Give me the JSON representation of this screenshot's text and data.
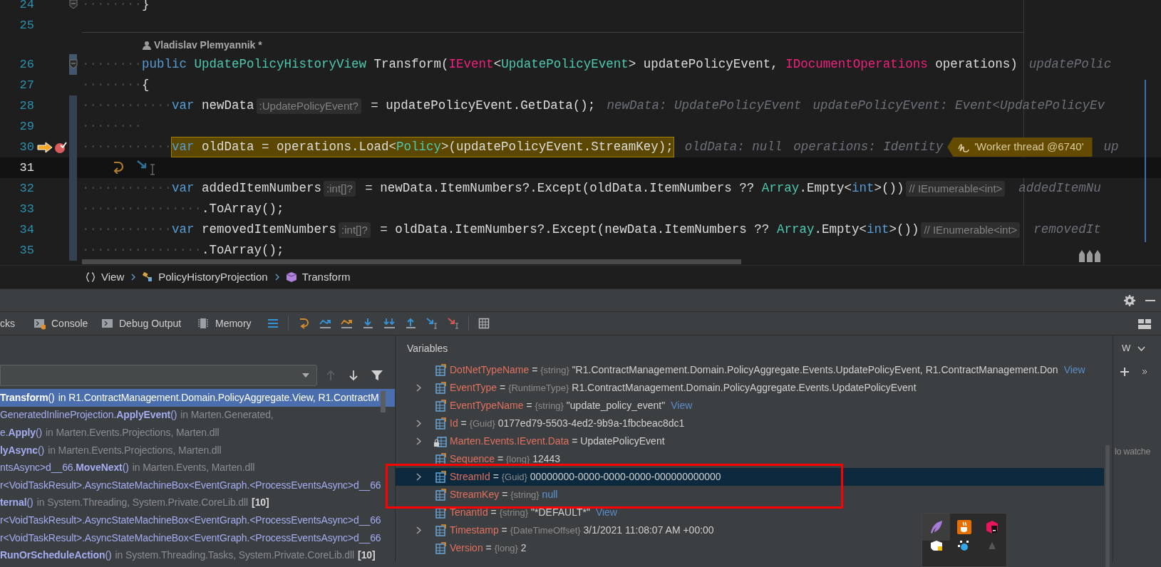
{
  "editor": {
    "lines": [
      {
        "number": "24",
        "indent": "········",
        "fold": true,
        "tokens": [
          {
            "kind": "plain",
            "text": "}"
          }
        ]
      },
      {
        "number": "25"
      },
      {
        "number": "26",
        "indent": "········",
        "fold": true,
        "changed": true,
        "author": "Vladislav Plemyannik *",
        "tokens": [
          {
            "kind": "kw",
            "text": "public "
          },
          {
            "kind": "type",
            "text": "UpdatePolicyHistoryView"
          },
          {
            "kind": "plain",
            "text": " Transform("
          },
          {
            "kind": "iface",
            "text": "IEvent"
          },
          {
            "kind": "plain",
            "text": "<"
          },
          {
            "kind": "type",
            "text": "UpdatePolicyEvent"
          },
          {
            "kind": "plain",
            "text": "> updatePolicyEvent, "
          },
          {
            "kind": "iface",
            "text": "IDocumentOperations"
          },
          {
            "kind": "plain",
            "text": " operations)"
          },
          {
            "kind": "trail",
            "text": "updatePolic"
          }
        ]
      },
      {
        "number": "27",
        "indent": "········",
        "tokens": [
          {
            "kind": "plain",
            "text": "{"
          }
        ]
      },
      {
        "number": "28",
        "indent": "············",
        "changed": true,
        "tokens": [
          {
            "kind": "kw",
            "text": "var"
          },
          {
            "kind": "plain",
            "text": " newData"
          },
          {
            "kind": "inlay",
            "text": ":UpdatePolicyEvent?"
          },
          {
            "kind": "plain",
            "text": " = updatePolicyEvent.GetData();"
          },
          {
            "kind": "trail",
            "text": "newData: UpdatePolicyEvent"
          },
          {
            "kind": "trail",
            "text": "updatePolicyEvent: Event<UpdatePolicyEv"
          }
        ]
      },
      {
        "number": "29",
        "indent": "········",
        "changed": true
      },
      {
        "number": "30",
        "indent": "············",
        "changed": true,
        "execution": true,
        "breakpoint": true,
        "tokens": [
          {
            "kind": "kw",
            "text": "var"
          },
          {
            "kind": "plain",
            "text": " oldData = operations.Load<"
          },
          {
            "kind": "type",
            "text": "Policy"
          },
          {
            "kind": "plain",
            "text": ">(updatePolicyEvent.StreamKey);"
          },
          {
            "kind": "trail",
            "text": "oldData: null"
          },
          {
            "kind": "trail",
            "text": "operations: Identity"
          },
          {
            "kind": "tag",
            "text": "'Worker thread @6740'"
          },
          {
            "kind": "trail",
            "text": "up"
          }
        ]
      },
      {
        "number": "31",
        "changed": true,
        "current": true
      },
      {
        "number": "32",
        "indent": "············",
        "changed": true,
        "tokens": [
          {
            "kind": "kw",
            "text": "var"
          },
          {
            "kind": "plain",
            "text": " addedItemNumbers"
          },
          {
            "kind": "inlay",
            "text": ":int[]?"
          },
          {
            "kind": "plain",
            "text": " = newData.ItemNumbers?.Except(oldData.ItemNumbers ?? "
          },
          {
            "kind": "type",
            "text": "Array"
          },
          {
            "kind": "plain",
            "text": ".Empty<"
          },
          {
            "kind": "kw",
            "text": "int"
          },
          {
            "kind": "plain",
            "text": ">())"
          },
          {
            "kind": "inlay",
            "text": "// IEnumerable<int>"
          },
          {
            "kind": "trail",
            "text": "addedItemNu"
          }
        ]
      },
      {
        "number": "33",
        "indent": "················",
        "changed": true,
        "tokens": [
          {
            "kind": "plain",
            "text": ".ToArray();"
          }
        ]
      },
      {
        "number": "34",
        "indent": "············",
        "changed": true,
        "tokens": [
          {
            "kind": "kw",
            "text": "var"
          },
          {
            "kind": "plain",
            "text": " removedItemNumbers"
          },
          {
            "kind": "inlay",
            "text": ":int[]?"
          },
          {
            "kind": "plain",
            "text": " = oldData.ItemNumbers?.Except(newData.ItemNumbers ?? "
          },
          {
            "kind": "type",
            "text": "Array"
          },
          {
            "kind": "plain",
            "text": ".Empty<"
          },
          {
            "kind": "kw",
            "text": "int"
          },
          {
            "kind": "plain",
            "text": ">())"
          },
          {
            "kind": "inlay",
            "text": "// IEnumerable<int>"
          },
          {
            "kind": "trail",
            "text": "removedIt"
          }
        ]
      },
      {
        "number": "35",
        "indent": "················",
        "changed": true,
        "tokens": [
          {
            "kind": "plain",
            "text": ".ToArray();"
          }
        ]
      }
    ]
  },
  "breadcrumbs": [
    {
      "kind": "namespace",
      "label": "View"
    },
    {
      "kind": "class",
      "label": "PolicyHistoryProjection"
    },
    {
      "kind": "method",
      "label": "Transform"
    }
  ],
  "debug_tabs": [
    {
      "kind": "plain",
      "label": "cks"
    },
    {
      "kind": "console",
      "label": "Console"
    },
    {
      "kind": "output",
      "label": "Debug Output"
    },
    {
      "kind": "memory",
      "label": "Memory"
    }
  ],
  "frames": [
    {
      "call": "**Transform**()",
      "location": "in R1.ContractManagement.Domain.PolicyAggregate.View, R1.ContractM",
      "selected": true
    },
    {
      "call": "GeneratedInlineProjection.**ApplyEvent**()",
      "location": "in Marten.Generated,",
      "selected": false
    },
    {
      "call": "e.**Apply**()",
      "location": "in Marten.Events.Projections, Marten.dll",
      "selected": false
    },
    {
      "call": "**lyAsync**()",
      "location": "in Marten.Events.Projections, Marten.dll",
      "selected": false
    },
    {
      "call": "ntsAsync>d__66.**MoveNext**()",
      "location": "in Marten.Events, Marten.dll",
      "selected": false
    },
    {
      "call": "r<VoidTaskResult>.AsyncStateMachineBox<EventGraph.<ProcessEventsAsync>d__66",
      "selected": false
    },
    {
      "call": "**ternal**()",
      "location": "in System.Threading, System.Private.CoreLib.dll",
      "count": "[10]",
      "selected": false
    },
    {
      "call": "r<VoidTaskResult>.AsyncStateMachineBox<EventGraph.<ProcessEventsAsync>d__66",
      "selected": false
    },
    {
      "call": "r<VoidTaskResult>.AsyncStateMachineBox<EventGraph.<ProcessEventsAsync>d__66",
      "selected": false
    },
    {
      "call": "**RunOrScheduleAction**()",
      "location": "in System.Threading.Tasks, System.Private.CoreLib.dll",
      "count": "[10]",
      "selected": false
    }
  ],
  "variables": {
    "title": "Variables",
    "rows": [
      {
        "kind": "field",
        "name": "DotNetTypeName",
        "sep": "=",
        "type": "{string}",
        "value": "\"R1.ContractManagement.Domain.PolicyAggregate.Events.UpdatePolicyEvent, R1.ContractManagement.Don",
        "literal": false,
        "link": "View",
        "expandable": false,
        "selected": false
      },
      {
        "kind": "field",
        "name": "EventType",
        "sep": "=",
        "type": "{RuntimeType}",
        "value": "R1.ContractManagement.Domain.PolicyAggregate.Events.UpdatePolicyEvent",
        "literal": false,
        "expandable": true,
        "selected": false
      },
      {
        "kind": "field",
        "name": "EventTypeName",
        "sep": "=",
        "type": "{string}",
        "value": "\"update_policy_event\"",
        "literal": false,
        "link": "View",
        "expandable": false,
        "selected": false
      },
      {
        "kind": "field",
        "name": "Id",
        "sep": "=",
        "type": "{Guid}",
        "value": "0177ed79-5503-4ed2-9b9a-1fbcbeac8dc1",
        "literal": false,
        "expandable": true,
        "selected": false
      },
      {
        "kind": "locked",
        "name": "Marten.Events.IEvent.Data",
        "sep": "=",
        "value": "UpdatePolicyEvent",
        "literal": false,
        "expandable": true,
        "selected": false
      },
      {
        "kind": "field",
        "name": "Sequence",
        "sep": "=",
        "type": "{long}",
        "value": "12443",
        "literal": false,
        "expandable": false,
        "selected": false
      },
      {
        "kind": "field",
        "name": "StreamId",
        "sep": "=",
        "type": "{Guid}",
        "value": "00000000-0000-0000-0000-000000000000",
        "literal": false,
        "expandable": true,
        "selected": true
      },
      {
        "kind": "field",
        "name": "StreamKey",
        "sep": "=",
        "type": "{string}",
        "value": "null",
        "literal": true,
        "expandable": false,
        "selected": false
      },
      {
        "kind": "field",
        "name": "TenantId",
        "sep": "=",
        "type": "{string}",
        "value": "\"*DEFAULT*\"",
        "literal": false,
        "link": "View",
        "expandable": false,
        "selected": false
      },
      {
        "kind": "field",
        "name": "Timestamp",
        "sep": "=",
        "type": "{DateTimeOffset}",
        "value": "3/1/2021 11:08:07 AM +00:00",
        "literal": false,
        "expandable": true,
        "selected": false
      },
      {
        "kind": "field",
        "name": "Version",
        "sep": "=",
        "type": "{long}",
        "value": "2",
        "literal": false,
        "expandable": false,
        "selected": false
      }
    ]
  },
  "watches": {
    "title": "W",
    "empty_text": "lo watche"
  }
}
